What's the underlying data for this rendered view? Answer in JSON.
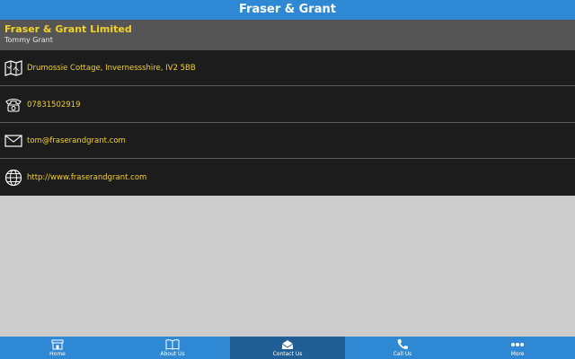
{
  "header": {
    "title": "Fraser & Grant"
  },
  "company": {
    "name": "Fraser & Grant Limited",
    "contact": "Tommy Grant"
  },
  "rows": [
    {
      "icon": "map-icon",
      "text": "Drumossie Cottage, Invernessshire, IV2 5BB"
    },
    {
      "icon": "phone-icon",
      "text": "07831502919"
    },
    {
      "icon": "mail-icon",
      "text": "tom@fraserandgrant.com"
    },
    {
      "icon": "globe-icon",
      "text": "http://www.fraserandgrant.com"
    }
  ],
  "tabs": [
    {
      "label": "Home",
      "icon": "home-icon"
    },
    {
      "label": "About Us",
      "icon": "book-icon"
    },
    {
      "label": "Contact Us",
      "icon": "envelope-icon",
      "active": true
    },
    {
      "label": "Call Us",
      "icon": "phone-handset-icon"
    },
    {
      "label": "More",
      "icon": "more-dots-icon"
    }
  ],
  "colors": {
    "accent": "#2f88d4",
    "highlight_text": "#f3d22a",
    "content_bg": "#cccccc",
    "row_bg": "#1c1c1c"
  }
}
